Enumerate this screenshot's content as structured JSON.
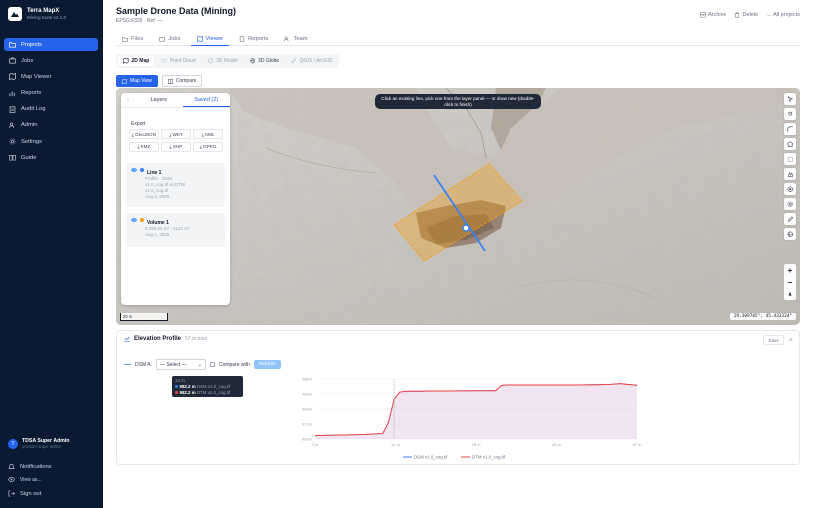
{
  "app": {
    "name": "Terra MapX",
    "subtitle": "Mining Suite v2.1.0"
  },
  "sidebar": {
    "items": [
      {
        "label": "Projects",
        "icon": "folder-icon"
      },
      {
        "label": "Jobs",
        "icon": "briefcase-icon"
      },
      {
        "label": "Map Viewer",
        "icon": "map-icon"
      },
      {
        "label": "Reports",
        "icon": "bar-chart-icon"
      },
      {
        "label": "Audit Log",
        "icon": "clipboard-icon"
      },
      {
        "label": "Admin",
        "icon": "users-icon"
      },
      {
        "label": "Settings",
        "icon": "gear-icon"
      },
      {
        "label": "Guide",
        "icon": "book-icon"
      }
    ],
    "user": {
      "name": "TDSA Super Admin",
      "role": "provider super admin",
      "initial": "T"
    },
    "notifications": "Notifications",
    "view_as": "View as...",
    "sign_out": "Sign out"
  },
  "header": {
    "title": "Sample Drone Data (Mining)",
    "subtitle": "EPSG:6326 · Ref: —",
    "archive": "Archive",
    "delete": "Delete",
    "all_projects": "← All projects"
  },
  "tabs": [
    {
      "label": "Files",
      "icon": "folder-icon"
    },
    {
      "label": "Jobs",
      "icon": "briefcase-icon"
    },
    {
      "label": "Viewer",
      "icon": "map-icon"
    },
    {
      "label": "Reports",
      "icon": "file-icon"
    },
    {
      "label": "Team",
      "icon": "users-icon"
    }
  ],
  "active_tab": "Viewer",
  "view_modes": [
    "2D Map",
    "Point Cloud",
    "3D Model",
    "3D Globe",
    "QGIS / ArcGIS"
  ],
  "map_toggle": {
    "map_view": "Map View",
    "compare": "Compare"
  },
  "map": {
    "hint": "Click an existing line, pick one from the layer panel — or draw new (double-click to finish)",
    "scale": "20 m",
    "coords": "29.309705°, 45.433324°"
  },
  "layer_panel": {
    "back": "‹",
    "tab_layers": "Layers",
    "tab_saved": "Saved (2)",
    "export_label": "Export",
    "exports": [
      "⤓ GeoJSON",
      "⤓ WKT",
      "⤓ KML",
      "⤓ KMZ",
      "⤓ SHP",
      "⤓ GPKG"
    ],
    "items": [
      {
        "name": "Line 1",
        "desc1": "Profile · DSM",
        "desc2": "v1.0_cog.tif vs DTM",
        "desc3": "v1.0_cog.tif",
        "date": "Aug 4, 2026",
        "color": "#3b82f6"
      },
      {
        "name": "Volume 1",
        "desc1": "8,395.65 m³ · 2121 m²",
        "desc2": "",
        "desc3": "",
        "date": "Aug 4, 2026",
        "color": "#f59e0b"
      }
    ]
  },
  "elevation": {
    "title": "Elevation Profile",
    "points": "57 m total",
    "save": "Save",
    "close": "×",
    "dsm_label": "DSM A:",
    "select_placeholder": "— Select —",
    "compare_with": "Compare with",
    "refresh": "Refresh",
    "tooltip": {
      "header": "14 m",
      "l1": "982.2 m",
      "l1b": "DSM v1.0_cog.tif",
      "l2": "982.2 m",
      "l2b": "DTM v1.0_cog.tif"
    }
  },
  "chart_data": {
    "type": "area",
    "yticks": [
      "986m",
      "984m",
      "983m",
      "971m",
      "965m"
    ],
    "xticks": [
      "0 m",
      "14 m",
      "28 m",
      "43 m",
      "57 m"
    ],
    "x": [
      0,
      3,
      6,
      9,
      12,
      13,
      14,
      15,
      16,
      18,
      21,
      24,
      28,
      32,
      33,
      34,
      40,
      46,
      50,
      52,
      54,
      55,
      56,
      57
    ],
    "series": [
      {
        "name": "DSM v1.0_cog.tif",
        "color": "#3b82f6",
        "values": [
          965.3,
          965.4,
          965.5,
          965.7,
          966.0,
          970.0,
          978.5,
          981.2,
          981.5,
          981.5,
          981.6,
          981.6,
          981.7,
          981.7,
          983.6,
          983.8,
          983.8,
          983.8,
          983.9,
          984.0,
          984.3,
          984.1,
          983.9,
          983.7
        ]
      },
      {
        "name": "DTM v1.0_cog.tif",
        "color": "#ef4444",
        "values": [
          965.3,
          965.4,
          965.5,
          965.7,
          966.0,
          970.0,
          978.5,
          981.2,
          981.5,
          981.5,
          981.6,
          981.6,
          981.7,
          981.7,
          983.6,
          983.8,
          983.8,
          983.8,
          983.9,
          984.0,
          984.3,
          984.1,
          983.9,
          983.7
        ]
      }
    ],
    "ylim": [
      964,
      986
    ],
    "cursor_x": 14,
    "legend": "bottom"
  },
  "colors": {
    "sidebar": "#0b1a33",
    "accent": "#2563eb",
    "profile_line": "#3b82f6",
    "volume": "#f59e0b"
  }
}
